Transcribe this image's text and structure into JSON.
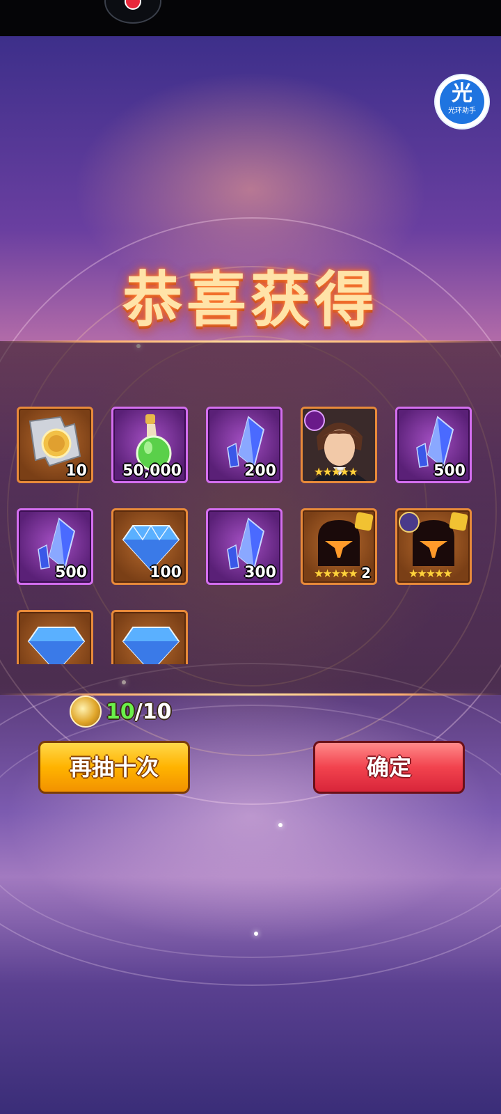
{
  "status_bar": {},
  "assistant": {
    "char": "光",
    "name": "光环助手"
  },
  "title": "恭喜获得",
  "rewards": [
    {
      "icon": "puzzle-coin-icon",
      "frame": "orange",
      "qty": "10"
    },
    {
      "icon": "green-potion-icon",
      "frame": "purple",
      "qty": "50,000"
    },
    {
      "icon": "blue-crystal-icon",
      "frame": "purple",
      "qty": "200"
    },
    {
      "icon": "hero-portrait-icon",
      "frame": "orange",
      "stars": "★★★★★"
    },
    {
      "icon": "blue-crystal-icon",
      "frame": "purple",
      "qty": "500"
    },
    {
      "icon": "blue-crystal-icon",
      "frame": "purple",
      "qty": "500"
    },
    {
      "icon": "blue-diamond-icon",
      "frame": "orange",
      "qty": "100"
    },
    {
      "icon": "blue-crystal-icon",
      "frame": "purple",
      "qty": "300"
    },
    {
      "icon": "hero-shard-icon",
      "frame": "orange",
      "stars": "★★★★★",
      "count": "2"
    },
    {
      "icon": "hero-shard-icon",
      "frame": "orange",
      "stars": "★★★★★"
    },
    {
      "icon": "blue-diamond-icon",
      "frame": "orange"
    },
    {
      "icon": "blue-diamond-icon",
      "frame": "orange"
    }
  ],
  "ticket": {
    "have": "10",
    "sep_total": "/10"
  },
  "buttons": {
    "draw_again": "再抽十次",
    "confirm": "确定"
  },
  "colors": {
    "accent_gold": "#ffb300",
    "confirm_red": "#f2434e",
    "count_green": "#6af04a"
  }
}
